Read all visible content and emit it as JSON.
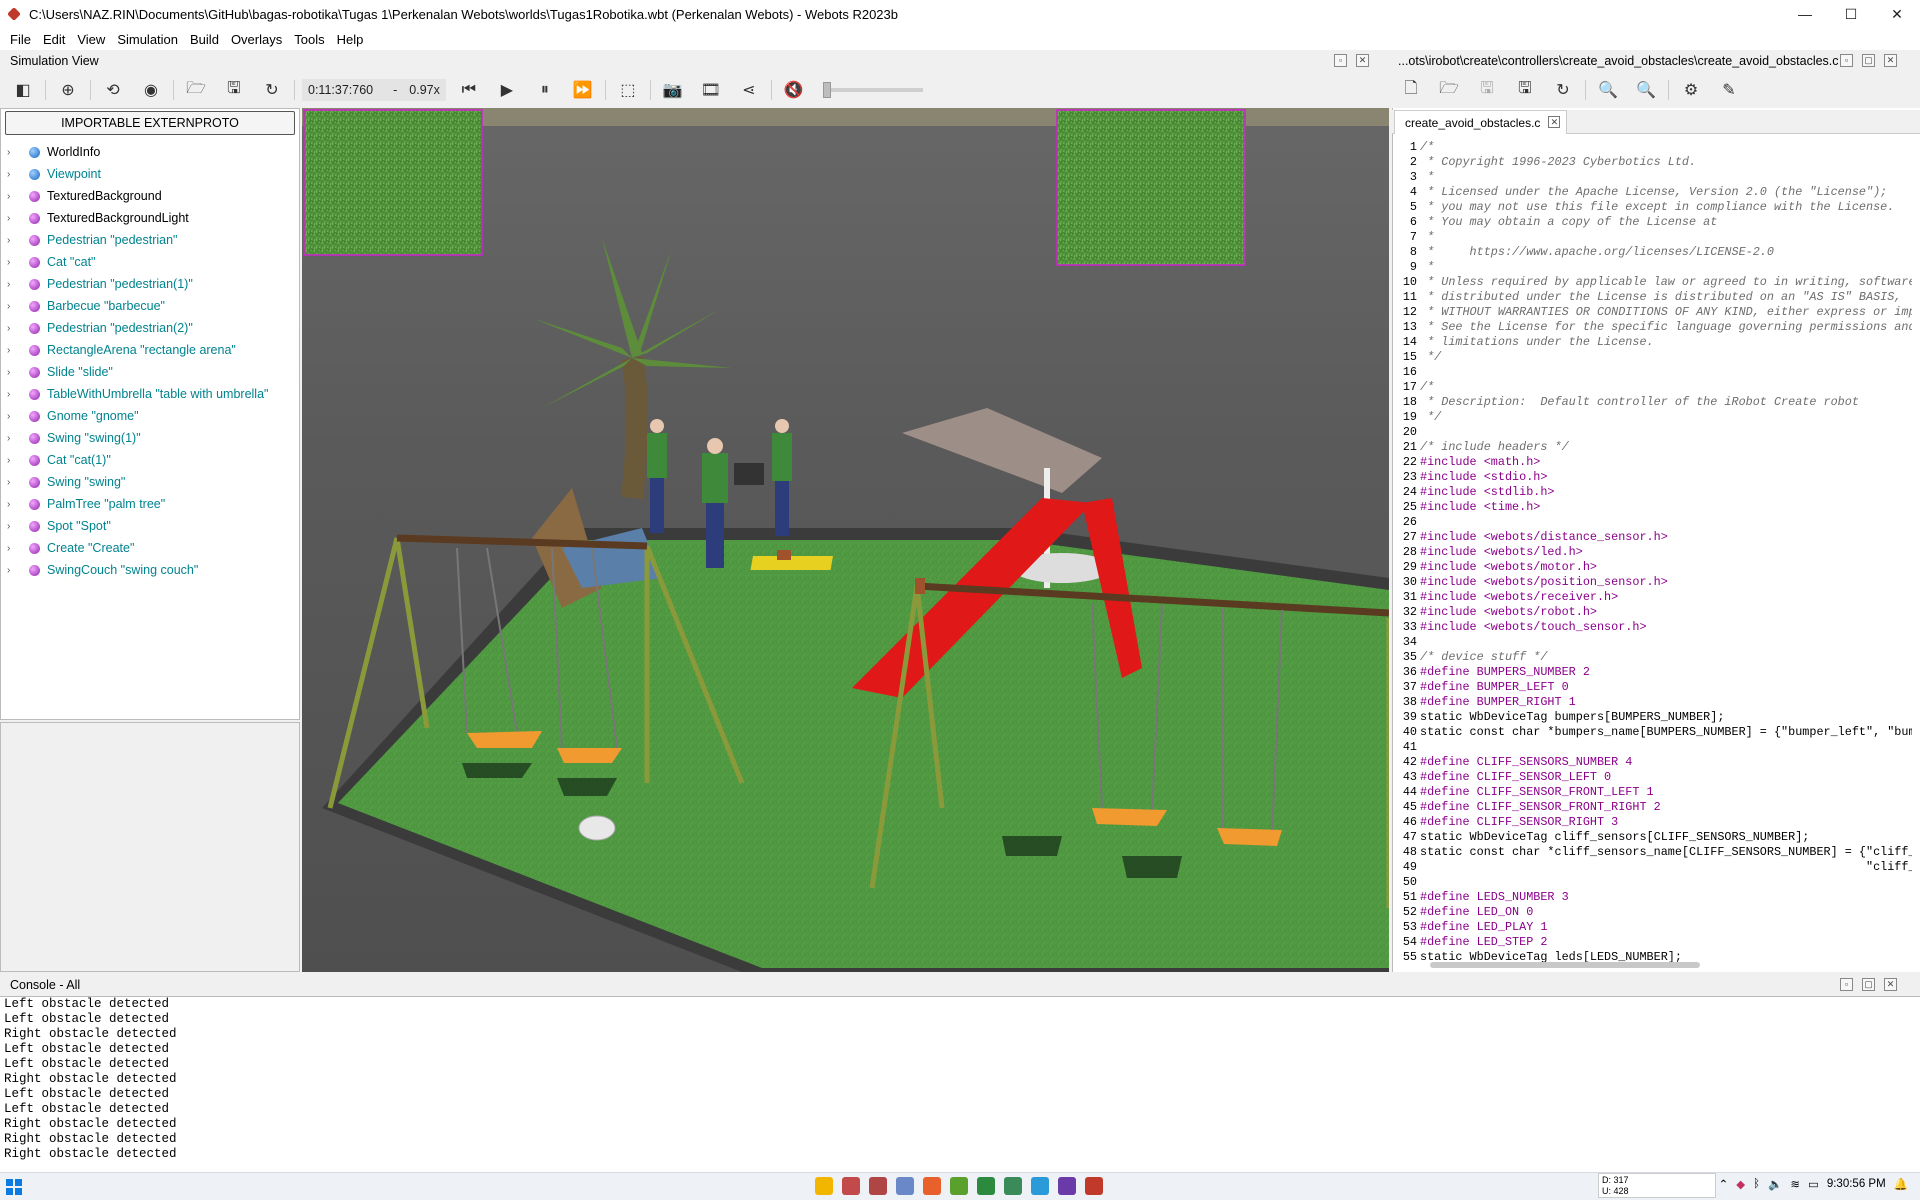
{
  "window": {
    "title": "C:\\Users\\NAZ.RIN\\Documents\\GitHub\\bagas-robotika\\Tugas 1\\Perkenalan Webots\\worlds\\Tugas1Robotika.wbt (Perkenalan Webots) - Webots R2023b",
    "minimize": "—",
    "maximize": "☐",
    "close": "✕"
  },
  "menu": [
    "File",
    "Edit",
    "View",
    "Simulation",
    "Build",
    "Overlays",
    "Tools",
    "Help"
  ],
  "simulation_view": {
    "header": "Simulation View",
    "time": "0:11:37:760",
    "dash": "-",
    "speed": "0.97x"
  },
  "scene_tree": {
    "proto_button": "IMPORTABLE EXTERNPROTO",
    "items": [
      {
        "label": "WorldInfo",
        "color": "blue"
      },
      {
        "label": "Viewpoint",
        "color": "blue"
      },
      {
        "label": "TexturedBackground",
        "color": "purple"
      },
      {
        "label": "TexturedBackgroundLight",
        "color": "purple"
      },
      {
        "label": "Pedestrian \"pedestrian\"",
        "color": "purple"
      },
      {
        "label": "Cat \"cat\"",
        "color": "purple"
      },
      {
        "label": "Pedestrian \"pedestrian(1)\"",
        "color": "purple"
      },
      {
        "label": "Barbecue \"barbecue\"",
        "color": "purple"
      },
      {
        "label": "Pedestrian \"pedestrian(2)\"",
        "color": "purple"
      },
      {
        "label": "RectangleArena \"rectangle arena\"",
        "color": "purple"
      },
      {
        "label": "Slide \"slide\"",
        "color": "purple"
      },
      {
        "label": "TableWithUmbrella \"table with umbrella\"",
        "color": "purple"
      },
      {
        "label": "Gnome \"gnome\"",
        "color": "purple"
      },
      {
        "label": "Swing \"swing(1)\"",
        "color": "purple"
      },
      {
        "label": "Cat \"cat(1)\"",
        "color": "purple"
      },
      {
        "label": "Swing \"swing\"",
        "color": "purple"
      },
      {
        "label": "PalmTree \"palm tree\"",
        "color": "purple"
      },
      {
        "label": "Spot \"Spot\"",
        "color": "purple"
      },
      {
        "label": "Create \"Create\"",
        "color": "purple"
      },
      {
        "label": "SwingCouch \"swing couch\"",
        "color": "purple"
      }
    ]
  },
  "editor": {
    "path": "...ots\\irobot\\create\\controllers\\create_avoid_obstacles\\create_avoid_obstacles.c",
    "tab": "create_avoid_obstacles.c",
    "lines": [
      {
        "n": "1",
        "t": "/*",
        "k": "cm"
      },
      {
        "n": "2",
        "t": " * Copyright 1996-2023 Cyberbotics Ltd.",
        "k": "cm"
      },
      {
        "n": "3",
        "t": " *",
        "k": "cm"
      },
      {
        "n": "4",
        "t": " * Licensed under the Apache License, Version 2.0 (the \"License\");",
        "k": "cm"
      },
      {
        "n": "5",
        "t": " * you may not use this file except in compliance with the License.",
        "k": "cm"
      },
      {
        "n": "6",
        "t": " * You may obtain a copy of the License at",
        "k": "cm"
      },
      {
        "n": "7",
        "t": " *",
        "k": "cm"
      },
      {
        "n": "8",
        "t": " *     https://www.apache.org/licenses/LICENSE-2.0",
        "k": "cm"
      },
      {
        "n": "9",
        "t": " *",
        "k": "cm"
      },
      {
        "n": "10",
        "t": " * Unless required by applicable law or agreed to in writing, software",
        "k": "cm"
      },
      {
        "n": "11",
        "t": " * distributed under the License is distributed on an \"AS IS\" BASIS,",
        "k": "cm"
      },
      {
        "n": "12",
        "t": " * WITHOUT WARRANTIES OR CONDITIONS OF ANY KIND, either express or implied.",
        "k": "cm"
      },
      {
        "n": "13",
        "t": " * See the License for the specific language governing permissions and",
        "k": "cm"
      },
      {
        "n": "14",
        "t": " * limitations under the License.",
        "k": "cm"
      },
      {
        "n": "15",
        "t": " */",
        "k": "cm"
      },
      {
        "n": "16",
        "t": "",
        "k": "decl"
      },
      {
        "n": "17",
        "t": "/*",
        "k": "cm"
      },
      {
        "n": "18",
        "t": " * Description:  Default controller of the iRobot Create robot",
        "k": "cm"
      },
      {
        "n": "19",
        "t": " */",
        "k": "cm"
      },
      {
        "n": "20",
        "t": "",
        "k": "decl"
      },
      {
        "n": "21",
        "t": "/* include headers */",
        "k": "cm"
      },
      {
        "n": "22",
        "t": "#include <math.h>",
        "k": "pp"
      },
      {
        "n": "23",
        "t": "#include <stdio.h>",
        "k": "pp"
      },
      {
        "n": "24",
        "t": "#include <stdlib.h>",
        "k": "pp"
      },
      {
        "n": "25",
        "t": "#include <time.h>",
        "k": "pp"
      },
      {
        "n": "26",
        "t": "",
        "k": "decl"
      },
      {
        "n": "27",
        "t": "#include <webots/distance_sensor.h>",
        "k": "pp"
      },
      {
        "n": "28",
        "t": "#include <webots/led.h>",
        "k": "pp"
      },
      {
        "n": "29",
        "t": "#include <webots/motor.h>",
        "k": "pp"
      },
      {
        "n": "30",
        "t": "#include <webots/position_sensor.h>",
        "k": "pp"
      },
      {
        "n": "31",
        "t": "#include <webots/receiver.h>",
        "k": "pp"
      },
      {
        "n": "32",
        "t": "#include <webots/robot.h>",
        "k": "pp"
      },
      {
        "n": "33",
        "t": "#include <webots/touch_sensor.h>",
        "k": "pp"
      },
      {
        "n": "34",
        "t": "",
        "k": "decl"
      },
      {
        "n": "35",
        "t": "/* device stuff */",
        "k": "cm"
      },
      {
        "n": "36",
        "t": "#define BUMPERS_NUMBER 2",
        "k": "pp"
      },
      {
        "n": "37",
        "t": "#define BUMPER_LEFT 0",
        "k": "pp"
      },
      {
        "n": "38",
        "t": "#define BUMPER_RIGHT 1",
        "k": "pp"
      },
      {
        "n": "39",
        "t": "static WbDeviceTag bumpers[BUMPERS_NUMBER];",
        "k": "decl"
      },
      {
        "n": "40",
        "t": "static const char *bumpers_name[BUMPERS_NUMBER] = {\"bumper_left\", \"bumper_right\"};",
        "k": "decl"
      },
      {
        "n": "41",
        "t": "",
        "k": "decl"
      },
      {
        "n": "42",
        "t": "#define CLIFF_SENSORS_NUMBER 4",
        "k": "pp"
      },
      {
        "n": "43",
        "t": "#define CLIFF_SENSOR_LEFT 0",
        "k": "pp"
      },
      {
        "n": "44",
        "t": "#define CLIFF_SENSOR_FRONT_LEFT 1",
        "k": "pp"
      },
      {
        "n": "45",
        "t": "#define CLIFF_SENSOR_FRONT_RIGHT 2",
        "k": "pp"
      },
      {
        "n": "46",
        "t": "#define CLIFF_SENSOR_RIGHT 3",
        "k": "pp"
      },
      {
        "n": "47",
        "t": "static WbDeviceTag cliff_sensors[CLIFF_SENSORS_NUMBER];",
        "k": "decl"
      },
      {
        "n": "48",
        "t": "static const char *cliff_sensors_name[CLIFF_SENSORS_NUMBER] = {\"cliff_left\", \"cliff_front_left\",",
        "k": "decl"
      },
      {
        "n": "49",
        "t": "                                                               \"cliff_front_right\", \"cliff_right\"};",
        "k": "decl"
      },
      {
        "n": "50",
        "t": "",
        "k": "decl"
      },
      {
        "n": "51",
        "t": "#define LEDS_NUMBER 3",
        "k": "pp"
      },
      {
        "n": "52",
        "t": "#define LED_ON 0",
        "k": "pp"
      },
      {
        "n": "53",
        "t": "#define LED_PLAY 1",
        "k": "pp"
      },
      {
        "n": "54",
        "t": "#define LED_STEP 2",
        "k": "pp"
      },
      {
        "n": "55",
        "t": "static WbDeviceTag leds[LEDS_NUMBER];",
        "k": "decl"
      }
    ]
  },
  "console": {
    "header": "Console - All",
    "lines": [
      "Left obstacle detected",
      "Left obstacle detected",
      "Right obstacle detected",
      "Left obstacle detected",
      "Left obstacle detected",
      "Right obstacle detected",
      "Left obstacle detected",
      "Left obstacle detected",
      "Right obstacle detected",
      "Right obstacle detected",
      "Right obstacle detected"
    ]
  },
  "taskbar": {
    "net_down": "D: 317",
    "net_up": "U: 428",
    "clock": "9:30:56 PM"
  }
}
